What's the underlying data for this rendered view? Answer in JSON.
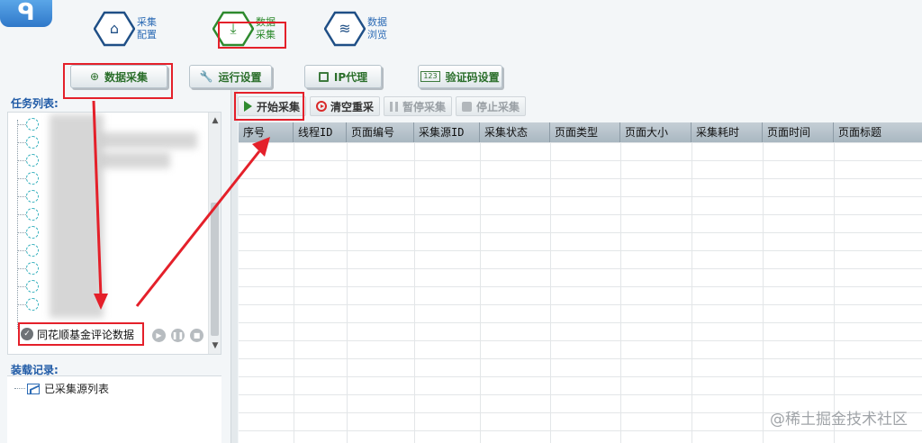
{
  "nav": {
    "logo_glyph": "ᑫ",
    "items": [
      {
        "line1": "采集",
        "line2": "配置",
        "icon": "home-icon"
      },
      {
        "line1": "数据",
        "line2": "采集",
        "icon": "download-icon"
      },
      {
        "line1": "数据",
        "line2": "浏览",
        "icon": "layers-icon"
      }
    ]
  },
  "functions": [
    {
      "label": "数据采集",
      "icon": "download-circle-icon",
      "glyph": "⊕"
    },
    {
      "label": "运行设置",
      "icon": "wrench-icon",
      "glyph": "🔧"
    },
    {
      "label": "IP代理",
      "icon": "frame-icon",
      "glyph": ""
    },
    {
      "label": "验证码设置",
      "icon": "captcha-123-icon",
      "glyph": "123"
    }
  ],
  "left": {
    "task_list_title": "任务列表:",
    "task_name": "同花顺基金评论数据",
    "task_check_glyph": "✓",
    "task_buttons": [
      {
        "glyph": "▶",
        "icon": "play-icon"
      },
      {
        "glyph": "❚❚",
        "icon": "pause-icon"
      },
      {
        "glyph": "■",
        "icon": "stop-icon"
      }
    ],
    "scroll_up": "▲",
    "scroll_down": "▼",
    "records_title": "装载记录:",
    "record_item": "已采集源列表"
  },
  "toolbar": {
    "start": "开始采集",
    "clear": "清空重采",
    "pause": "暂停采集",
    "stop": "停止采集"
  },
  "grid": {
    "columns": [
      "序号",
      "线程ID",
      "页面编号",
      "采集源ID",
      "采集状态",
      "页面类型",
      "页面大小",
      "采集耗时",
      "页面时间",
      "页面标题"
    ]
  },
  "watermark": "@稀土掘金技术社区",
  "colors": {
    "highlight_red": "#e4202a",
    "accent_green": "#2e8a2e",
    "accent_blue": "#2c6bb5"
  }
}
